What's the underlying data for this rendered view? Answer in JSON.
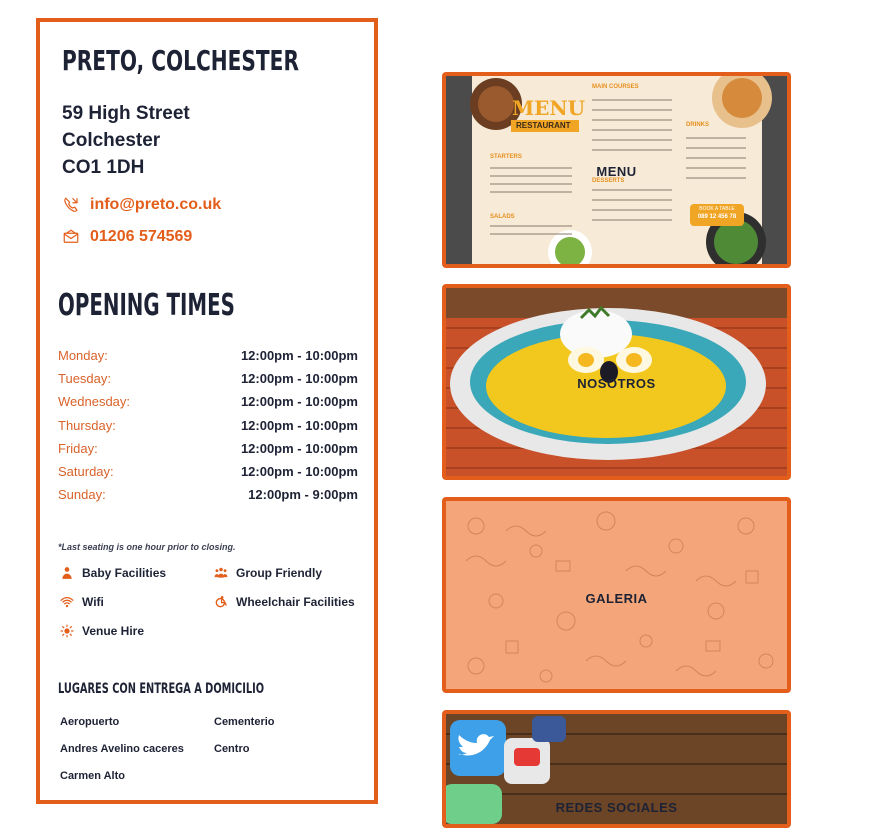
{
  "location": {
    "name": "PRETO, COLCHESTER",
    "address": [
      "59 High Street",
      "Colchester",
      "CO1 1DH"
    ],
    "email": "info@preto.co.uk",
    "phone": "01206 574569"
  },
  "opening": {
    "title": "OPENING TIMES",
    "days": [
      {
        "day": "Monday:",
        "time": "12:00pm - 10:00pm"
      },
      {
        "day": "Tuesday:",
        "time": "12:00pm - 10:00pm"
      },
      {
        "day": "Wednesday:",
        "time": "12:00pm - 10:00pm"
      },
      {
        "day": "Thursday:",
        "time": "12:00pm - 10:00pm"
      },
      {
        "day": "Friday:",
        "time": "12:00pm - 10:00pm"
      },
      {
        "day": "Saturday:",
        "time": "12:00pm - 10:00pm"
      },
      {
        "day": "Sunday:",
        "time": "12:00pm - 9:00pm"
      }
    ],
    "note": "*Last seating is one hour prior to closing."
  },
  "facilities": [
    "Baby Facilities",
    "Group Friendly",
    "Wifi",
    "Wheelchair Facilities",
    "Venue Hire"
  ],
  "delivery": {
    "title": "LUGARES CON ENTREGA A DOMICILIO",
    "places": [
      "Aeropuerto",
      "Cementerio",
      "Andres Avelino caceres",
      "Centro",
      "Carmen Alto"
    ]
  },
  "tiles": {
    "menu": {
      "label": "MENU",
      "menu_title": "MENU",
      "restaurant": "RESTAURANT",
      "main_courses": "MAIN COURSES",
      "drinks": "DRINKS",
      "starters": "STARTERS",
      "desserts": "DESSERTS",
      "salads": "SALADS",
      "book_label": "BOOK A TABLE",
      "book_phone": "089 12 456 78"
    },
    "nosotros": {
      "label": "NOSOTROS"
    },
    "galeria": {
      "label": "GALERIA"
    },
    "social": {
      "label": "REDES SOCIALES"
    }
  },
  "colors": {
    "accent": "#e35e1a",
    "text": "#1e2235"
  }
}
